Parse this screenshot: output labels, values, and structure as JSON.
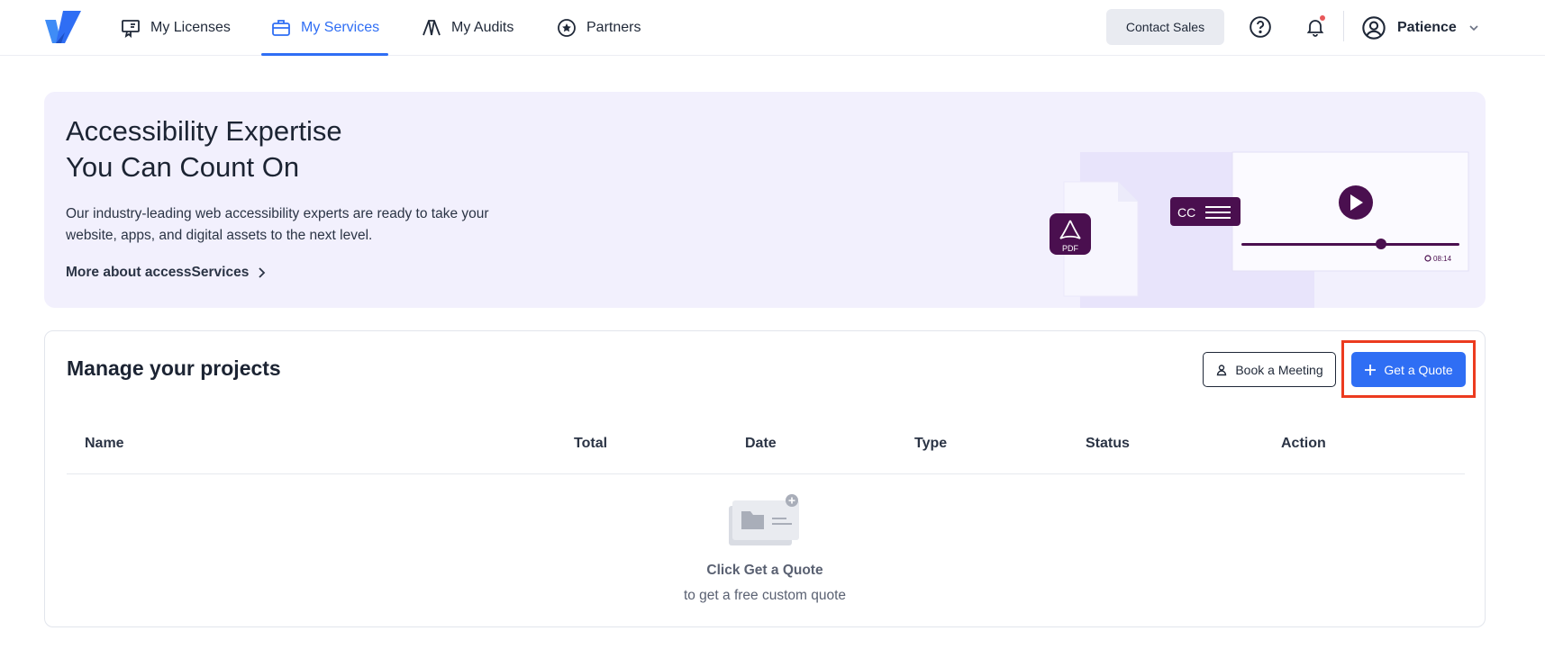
{
  "nav": {
    "items": [
      {
        "label": "My Licenses",
        "icon": "license-icon"
      },
      {
        "label": "My Services",
        "icon": "briefcase-icon",
        "active": true
      },
      {
        "label": "My Audits",
        "icon": "audit-icon"
      },
      {
        "label": "Partners",
        "icon": "star-badge-icon"
      }
    ],
    "contact_sales": "Contact Sales",
    "user_name": "Patience",
    "accent_color": "#2f6ef4"
  },
  "hero": {
    "title_line1": "Accessibility Expertise",
    "title_line2": "You Can Count On",
    "description": "Our industry-leading web accessibility experts are ready to take your website, apps, and digital assets to the next level.",
    "link_label": "More about accessServices",
    "art": {
      "pdf_label": "PDF",
      "cc_label": "CC",
      "video_time": "08:14"
    }
  },
  "projects": {
    "title": "Manage your projects",
    "book_meeting": "Book a Meeting",
    "get_quote": "Get a Quote",
    "columns": [
      "Name",
      "Total",
      "Date",
      "Type",
      "Status",
      "Action"
    ],
    "rows": [],
    "empty_title": "Click Get a Quote",
    "empty_subtitle": "to get a free custom quote"
  }
}
